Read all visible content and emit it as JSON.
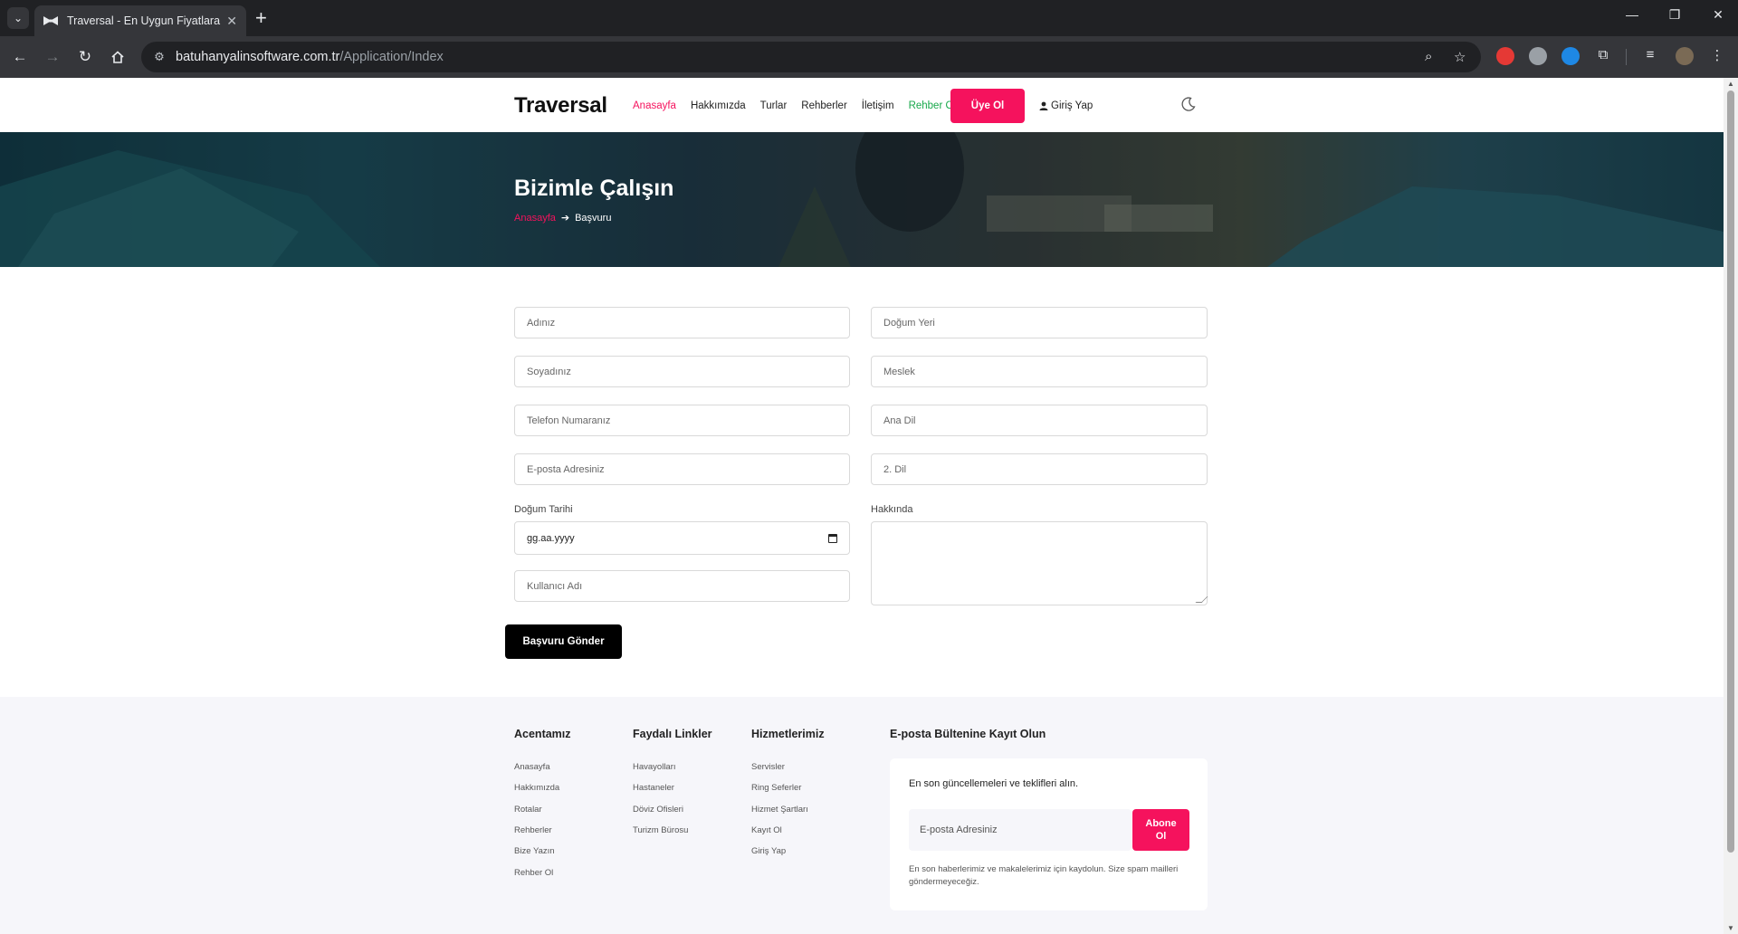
{
  "browser": {
    "tab_title": "Traversal - En Uygun Fiyatlara G",
    "url_domain": "batuhanyalinsoftware.com.tr",
    "url_path": "/Application/Index"
  },
  "header": {
    "brand": "Traversal",
    "nav": [
      "Anasayfa",
      "Hakkımızda",
      "Turlar",
      "Rehberler",
      "İletişim",
      "Rehber Ol"
    ],
    "signup": "Üye Ol",
    "login": "Giriş Yap"
  },
  "hero": {
    "title": "Bizimle Çalışın",
    "crumb_home": "Anasayfa",
    "crumb_current": "Başvuru"
  },
  "form": {
    "first_name": "Adınız",
    "last_name": "Soyadınız",
    "phone": "Telefon Numaranız",
    "email": "E-posta Adresiniz",
    "birth_date_label": "Doğum Tarihi",
    "birth_date_value": "gg.aa.yyyy",
    "username": "Kullanıcı Adı",
    "birth_place": "Doğum Yeri",
    "job": "Meslek",
    "native_lang": "Ana Dil",
    "second_lang": "2. Dil",
    "about_label": "Hakkında",
    "submit": "Başvuru Gönder"
  },
  "footer": {
    "col1": {
      "title": "Acentamız",
      "links": [
        "Anasayfa",
        "Hakkımızda",
        "Rotalar",
        "Rehberler",
        "Bize Yazın",
        "Rehber Ol"
      ]
    },
    "col2": {
      "title": "Faydalı Linkler",
      "links": [
        "Havayolları",
        "Hastaneler",
        "Döviz Ofisleri",
        "Turizm Bürosu"
      ]
    },
    "col3": {
      "title": "Hizmetlerimiz",
      "links": [
        "Servisler",
        "Ring Seferler",
        "Hizmet Şartları",
        "Kayıt Ol",
        "Giriş Yap"
      ]
    },
    "newsletter": {
      "title": "E-posta Bültenine Kayıt Olun",
      "lead": "En son güncellemeleri ve teklifleri alın.",
      "placeholder": "E-posta Adresiniz",
      "button": "Abone Ol",
      "note": "En son haberlerimiz ve makalelerimiz için kaydolun. Size spam mailleri göndermeyeceğiz."
    }
  },
  "colors": {
    "accent": "#f5125d",
    "guide": "#18a84b",
    "footer_bg": "#f6f6fa"
  }
}
